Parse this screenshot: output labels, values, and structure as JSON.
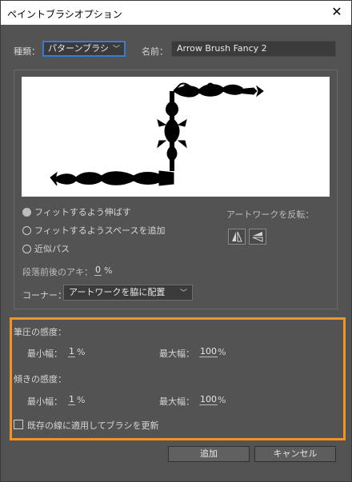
{
  "window": {
    "title": "ペイントブラシオプション",
    "close_glyph": "✕"
  },
  "type_label": "種類：",
  "type_value": "パターンブラシ",
  "name_label": "名前：",
  "name_value": "Arrow Brush Fancy 2",
  "fit_options": [
    {
      "label": "フィットするよう伸ばす",
      "selected": true
    },
    {
      "label": "フィットするようスペースを追加",
      "selected": false
    },
    {
      "label": "近似パス",
      "selected": false
    }
  ],
  "flip": {
    "label": "アートワークを反転："
  },
  "spacing": {
    "label": "段落前後のアキ：",
    "value": "0",
    "unit": "%"
  },
  "corner": {
    "label": "コーナー：",
    "value": "アートワークを脇に配置"
  },
  "pressure": {
    "label": "筆圧の感度：",
    "min_label": "最小幅：",
    "min_value": "1",
    "min_unit": "%",
    "max_label": "最大幅：",
    "max_value": "100",
    "max_unit": "%"
  },
  "tilt": {
    "label": "傾きの感度：",
    "min_label": "最小幅：",
    "min_value": "1",
    "min_unit": "%",
    "max_label": "最大幅：",
    "max_value": "100",
    "max_unit": "%"
  },
  "update_checkbox": {
    "label": "既存の線に適用してブラシを更新",
    "checked": false
  },
  "buttons": {
    "add": "追加",
    "cancel": "キャンセル"
  },
  "colors": {
    "highlight_border": "#f39321",
    "dialog_bg": "#535353",
    "focus": "#2f7fd8"
  }
}
